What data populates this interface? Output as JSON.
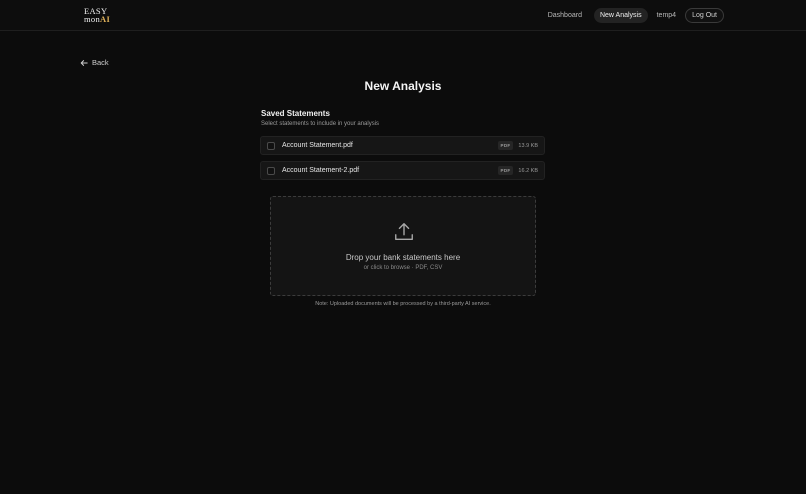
{
  "brand": {
    "line1": "EASY",
    "line2_a": "mon",
    "line2_b": "AI"
  },
  "nav": {
    "dashboard": "Dashboard",
    "new_analysis": "New Analysis",
    "user": "temp4",
    "logout": "Log Out"
  },
  "back_label": "Back",
  "page_title": "New Analysis",
  "saved": {
    "title": "Saved Statements",
    "subtitle": "Select statements to include in your analysis",
    "files": [
      {
        "name": "Account Statement.pdf",
        "type": "PDF",
        "size": "13.9 KB"
      },
      {
        "name": "Account Statement-2.pdf",
        "type": "PDF",
        "size": "16.2 KB"
      }
    ]
  },
  "dropzone": {
    "title": "Drop your bank statements here",
    "subtitle": "or click to browse · PDF, CSV"
  },
  "note": "Note: Uploaded documents will be processed by a third-party AI service.",
  "colors": {
    "background": "#0c0c0c",
    "accent": "#e0b25a"
  }
}
